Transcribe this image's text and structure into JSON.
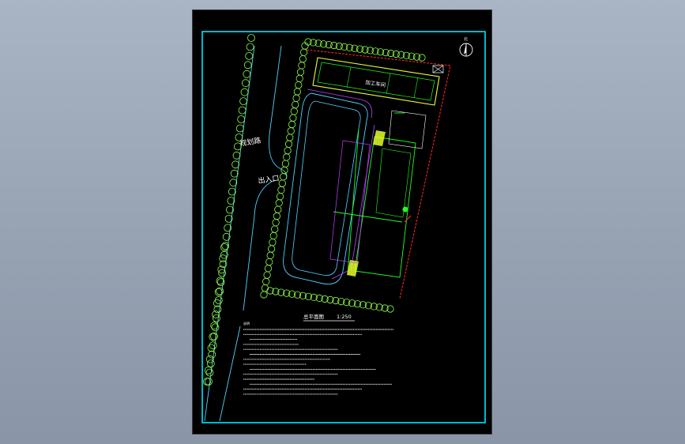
{
  "drawing": {
    "road_label": "规划路",
    "entrance_label": "出入口",
    "building_label": "加工车间",
    "north_label": "北",
    "scale_title": "总平面图",
    "scale_text": "1:250",
    "notes_heading": "说明",
    "note_count": 14
  },
  "colors": {
    "frame": "#00e5ff",
    "road": "#4fd3ff",
    "tree": "#8cff4a",
    "building": "#e8ff3a",
    "boundary": "#ff2a2a",
    "track": "#c040ff",
    "grid": "#22ff22",
    "hatch": "#e4ff2a"
  }
}
